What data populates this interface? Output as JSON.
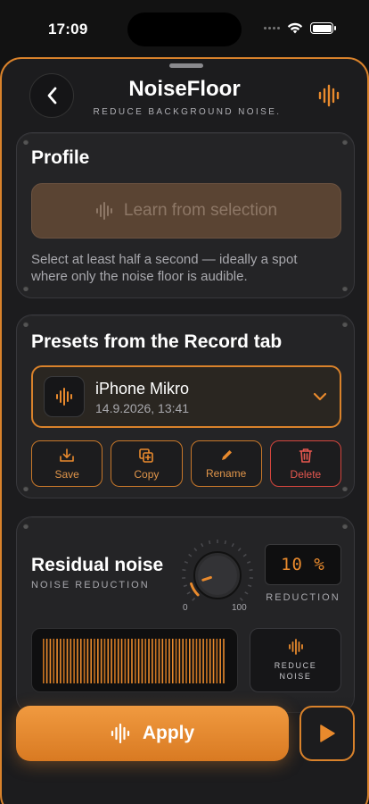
{
  "status_bar": {
    "time": "17:09"
  },
  "header": {
    "title": "NoiseFloor",
    "subtitle": "REDUCE BACKGROUND NOISE."
  },
  "profile": {
    "title": "Profile",
    "learn_button_label": "Learn from selection",
    "help_text": "Select at least half a second — ideally a spot where only the noise floor is audible."
  },
  "presets": {
    "title": "Presets from the Record tab",
    "selected": {
      "name": "iPhone Mikro",
      "date": "14.9.2026, 13:41"
    },
    "actions": {
      "save": "Save",
      "copy": "Copy",
      "rename": "Rename",
      "delete": "Delete"
    }
  },
  "residual": {
    "title": "Residual noise",
    "subtitle": "NOISE REDUCTION",
    "knob_value": 0.1,
    "knob_min": "0",
    "knob_max": "100",
    "percent_value": "10 %",
    "percent_label": "REDUCTION",
    "reduce_button_label": "REDUCE NOISE"
  },
  "footer": {
    "apply_label": "Apply"
  },
  "colors": {
    "accent": "#e98a2d",
    "danger": "#e5574f",
    "background": "#1c1c1e",
    "card": "#242426"
  },
  "icons": {
    "back": "chevron-left-icon",
    "header": "waveform-icon",
    "learn": "waveform-icon",
    "preset": "waveform-icon",
    "chevron": "chevron-down-icon",
    "save": "download-icon",
    "copy": "copy-icon",
    "rename": "pencil-icon",
    "delete": "trash-icon",
    "reduce": "waveform-icon",
    "apply": "waveform-icon",
    "play": "play-icon"
  }
}
